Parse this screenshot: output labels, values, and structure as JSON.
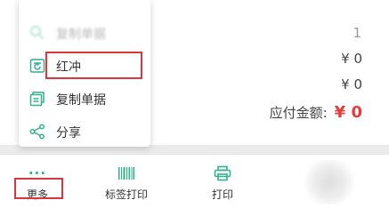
{
  "summary": {
    "rows": [
      {
        "label": "",
        "value": "1"
      },
      {
        "label": "",
        "value": "¥ 0"
      },
      {
        "label": "",
        "value": "¥ 0"
      }
    ],
    "payable_label": "应付金额:",
    "payable_value": "¥ 0"
  },
  "menu": {
    "items": [
      {
        "label": "复制单据",
        "icon": "faded-item-icon"
      },
      {
        "label": "红冲",
        "icon": "red-flush-icon"
      },
      {
        "label": "复制单据",
        "icon": "copy-document-icon"
      },
      {
        "label": "分享",
        "icon": "share-icon"
      }
    ]
  },
  "toolbar": {
    "items": [
      {
        "label": "更多",
        "icon": "more-dots-icon"
      },
      {
        "label": "标签打印",
        "icon": "barcode-icon"
      },
      {
        "label": "打印",
        "icon": "printer-icon"
      }
    ]
  },
  "colors": {
    "accent": "#2fb489",
    "highlight_border": "#d9363e",
    "amount_red": "#e73b3b"
  }
}
